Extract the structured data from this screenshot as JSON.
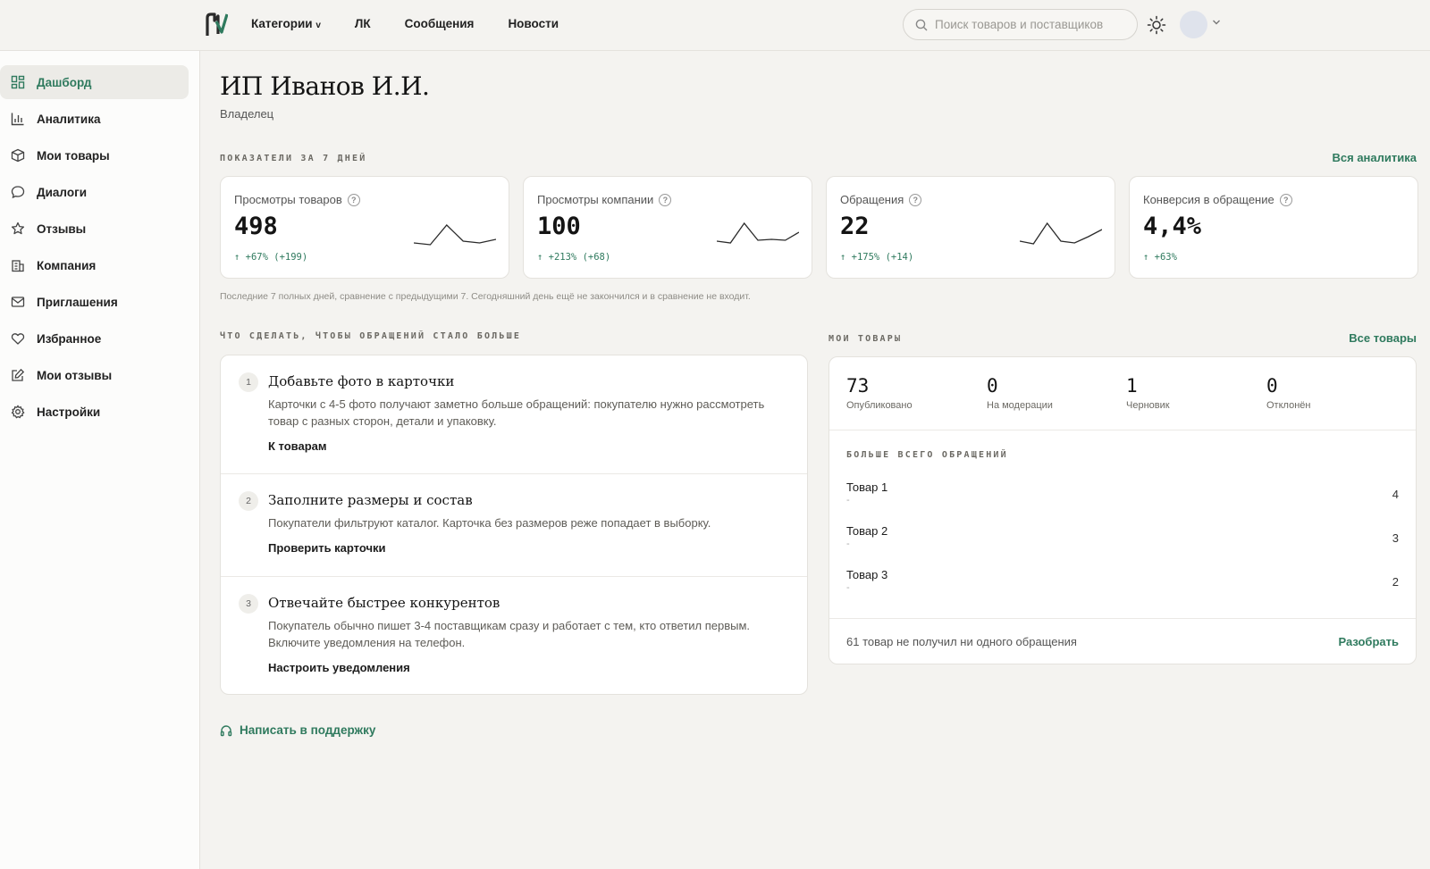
{
  "header": {
    "nav": {
      "categories": "Категории",
      "lk": "ЛК",
      "messages": "Сообщения",
      "news": "Новости"
    },
    "search_placeholder": "Поиск товаров и поставщиков"
  },
  "sidebar": {
    "items": [
      {
        "label": "Дашборд",
        "icon": "dashboard-icon"
      },
      {
        "label": "Аналитика",
        "icon": "chart-icon"
      },
      {
        "label": "Мои товары",
        "icon": "box-icon"
      },
      {
        "label": "Диалоги",
        "icon": "chat-icon"
      },
      {
        "label": "Отзывы",
        "icon": "star-icon"
      },
      {
        "label": "Компания",
        "icon": "building-icon"
      },
      {
        "label": "Приглашения",
        "icon": "mail-icon"
      },
      {
        "label": "Избранное",
        "icon": "heart-icon"
      },
      {
        "label": "Мои отзывы",
        "icon": "edit-icon"
      },
      {
        "label": "Настройки",
        "icon": "gear-icon"
      }
    ]
  },
  "page": {
    "title": "ИП Иванов И.И.",
    "subtitle": "Владелец"
  },
  "stats_section": {
    "label": "ПОКАЗАТЕЛИ ЗА 7 ДНЕЙ",
    "link": "Вся аналитика",
    "cards": [
      {
        "label": "Просмотры товаров",
        "value": "498",
        "delta": "↑ +67% (+199)",
        "spark": [
          30,
          32,
          10,
          28,
          30,
          26
        ]
      },
      {
        "label": "Просмотры компании",
        "value": "100",
        "delta": "↑ +213% (+68)",
        "spark": [
          28,
          30,
          8,
          27,
          26,
          27,
          18
        ]
      },
      {
        "label": "Обращения",
        "value": "22",
        "delta": "↑ +175% (+14)",
        "spark": [
          28,
          31,
          8,
          28,
          30,
          23,
          15
        ]
      },
      {
        "label": "Конверсия в обращение",
        "value": "4,4%",
        "delta": "↑ +63%",
        "spark": []
      }
    ],
    "footnote": "Последние 7 полных дней, сравнение с предыдущими 7. Сегодняшний день ещё не закончился и в сравнение не входит."
  },
  "tips_section": {
    "label": "ЧТО СДЕЛАТЬ, ЧТОБЫ ОБРАЩЕНИЙ СТАЛО БОЛЬШЕ",
    "items": [
      {
        "num": "1",
        "title": "Добавьте фото в карточки",
        "desc": "Карточки с 4-5 фото получают заметно больше обращений: покупателю нужно рассмотреть товар с разных сторон, детали и упаковку.",
        "link": "К товарам"
      },
      {
        "num": "2",
        "title": "Заполните размеры и состав",
        "desc": "Покупатели фильтруют каталог. Карточка без размеров реже попадает в выборку.",
        "link": "Проверить карточки"
      },
      {
        "num": "3",
        "title": "Отвечайте быстрее конкурентов",
        "desc": "Покупатель обычно пишет 3-4 поставщикам сразу и работает с тем, кто ответил первым. Включите уведомления на телефон.",
        "link": "Настроить уведомления"
      }
    ]
  },
  "support_link": "Написать в поддержку",
  "products_section": {
    "label": "МОИ ТОВАРЫ",
    "link": "Все товары",
    "stats": [
      {
        "value": "73",
        "label": "Опубликовано"
      },
      {
        "value": "0",
        "label": "На модерации"
      },
      {
        "value": "1",
        "label": "Черновик"
      },
      {
        "value": "0",
        "label": "Отклонён"
      }
    ],
    "top_label": "БОЛЬШЕ ВСЕГО ОБРАЩЕНИЙ",
    "top_items": [
      {
        "name": "Товар 1",
        "sub": "-",
        "count": "4"
      },
      {
        "name": "Товар 2",
        "sub": "-",
        "count": "3"
      },
      {
        "name": "Товар 3",
        "sub": "-",
        "count": "2"
      }
    ],
    "footer_text": "61 товар не получил ни одного обращения",
    "footer_link": "Разобрать"
  },
  "colors": {
    "accent": "#2f7a5e",
    "background": "#f4f3f0"
  }
}
